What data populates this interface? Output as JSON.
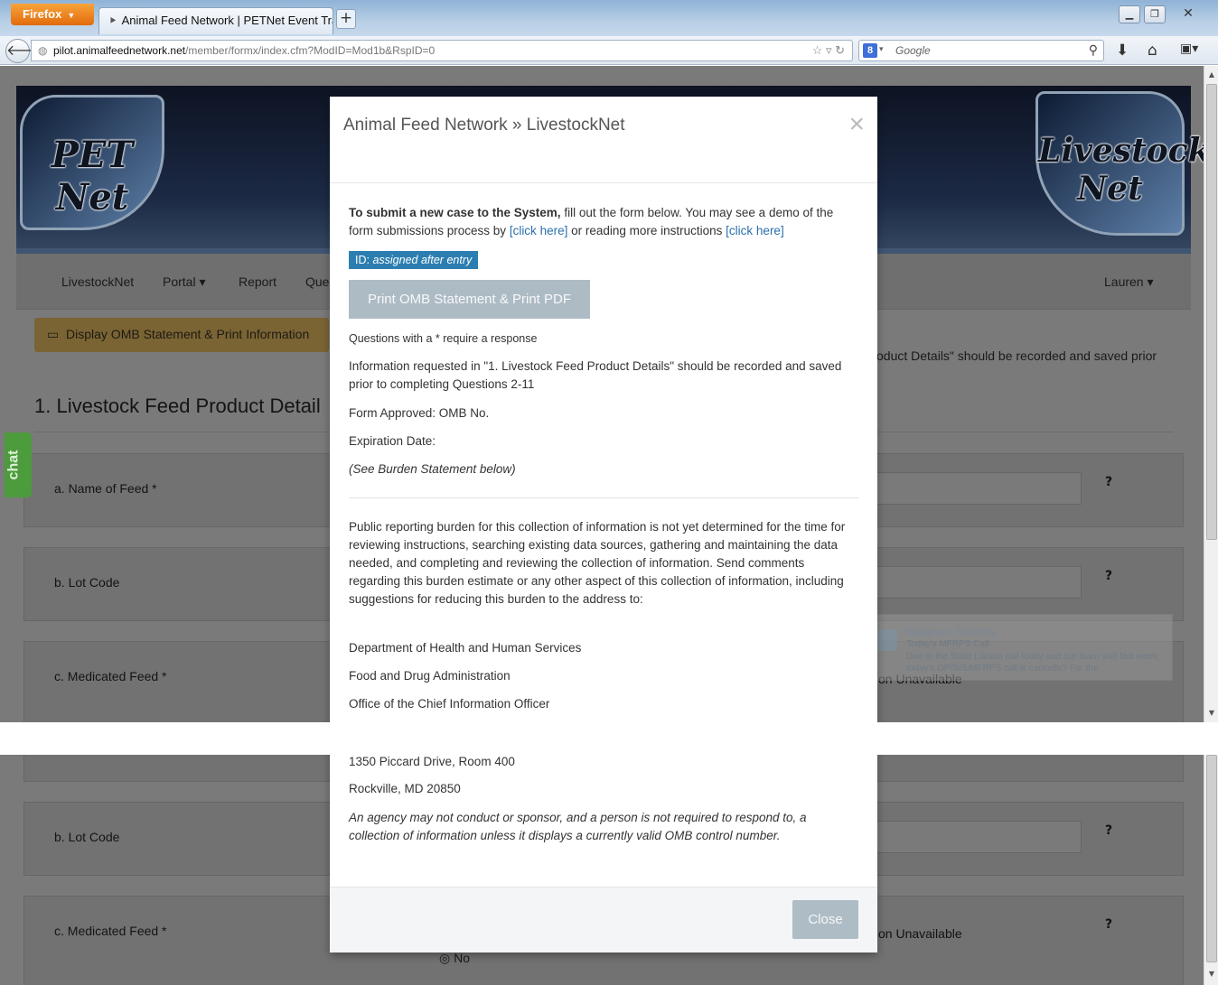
{
  "browser": {
    "app_button": "Firefox",
    "tab_title": "Animal Feed Network | PETNet Event Tra...",
    "url_host": "pilot.animalfeednetwork.net",
    "url_path": "/member/formx/index.cfm?ModID=Mod1b&RspID=0",
    "search_placeholder": "Google",
    "new_tab": "+"
  },
  "page": {
    "logo_left": "PET Net",
    "logo_right": "Livestock Net",
    "menu": [
      "LivestockNet",
      "Portal ▾",
      "Report",
      "Que"
    ],
    "user_menu": "Lauren ▾",
    "display_omb_button": "Display OMB Statement & Print Information",
    "bg_note": "oduct Details\" should be recorded and saved prior",
    "section_heading": "1. Livestock Feed Product Detail",
    "fields_top": [
      {
        "label": "a. Name of Feed *",
        "help": "?"
      },
      {
        "label": "b. Lot Code",
        "help": "?"
      },
      {
        "label": "c. Medicated Feed *",
        "extra": "on Unavailable"
      }
    ],
    "fields_bottom": [
      {
        "label": "b. Lot Code",
        "help": "?"
      },
      {
        "label": "c. Medicated Feed *",
        "help": "?",
        "extra": "on Unavailable"
      }
    ],
    "radio_no": "No",
    "chat_label": "chat"
  },
  "toast": {
    "sender": "Weigner, Timothy",
    "subject": "Today's MFRPS Call",
    "body": "Due to the State Liaison call today and our team visit last week, today's OP/SIS/MFRPS call is cancelle?  For the",
    "close": "▾ ✕"
  },
  "modal": {
    "title": "Animal Feed Network » LivestockNet",
    "close_x": "×",
    "intro_bold": "To submit a new case to the System,",
    "intro_text": " fill out the form below. You may see a demo of the form submissions process by ",
    "link_demo": "[click here]",
    "intro_text2": " or reading more instructions ",
    "link_instructions": "[click here]",
    "id_label": "ID: ",
    "id_value": "assigned after entry",
    "print_button": "Print OMB Statement & Print PDF",
    "required_note": "Questions with a * require a response",
    "info_requested": "Information requested in \"1. Livestock Feed Product Details\" should be recorded and saved prior to completing Questions 2-11",
    "form_approved": "Form Approved: OMB No.",
    "expiration": "Expiration Date:",
    "see_burden": "(See Burden Statement below)",
    "burden_text": "Public reporting burden for this collection of information is not yet determined for the time for reviewing instructions, searching existing data sources, gathering and maintaining the data needed, and completing and reviewing the collection of information. Send comments regarding this burden estimate or any other aspect of this collection of information, including suggestions for reducing this burden to the address to:",
    "address": [
      "Department of Health and Human Services",
      "Food and Drug Administration",
      "Office of the Chief Information Officer",
      "1350 Piccard Drive, Room 400",
      "Rockville, MD 20850"
    ],
    "disclaimer": "An agency may not conduct or sponsor, and a person is not required to respond to, a collection of information unless it displays a currently valid OMB control number.",
    "close_button": "Close"
  },
  "colors": {
    "accent_blue": "#2c7eb1",
    "link_blue": "#2b6fae",
    "button_disabled": "#adbbc4",
    "chat_green": "#4c9b3c",
    "firefox_orange": "#e36b0c"
  }
}
